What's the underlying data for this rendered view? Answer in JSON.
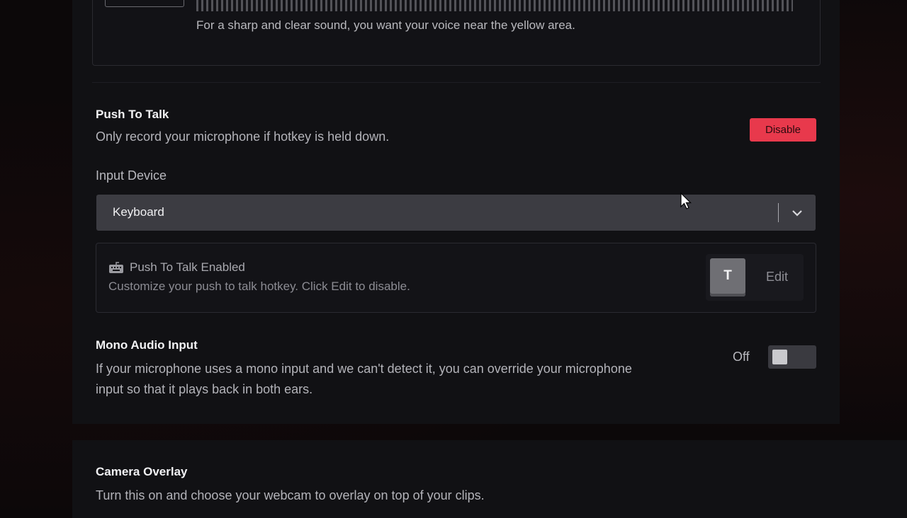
{
  "mic_level": {
    "hint": "For a sharp and clear sound, you want your voice near the yellow area."
  },
  "push_to_talk": {
    "title": "Push To Talk",
    "description": "Only record your microphone if hotkey is held down.",
    "disable_label": "Disable",
    "accent_color": "#e8394c",
    "input_device_label": "Input Device",
    "input_device_value": "Keyboard",
    "status_title": "Push To Talk Enabled",
    "status_description": "Customize your push to talk hotkey. Click Edit to disable.",
    "hotkey": "T",
    "edit_label": "Edit",
    "icons": {
      "status": "keyboard-icon",
      "dropdown": "chevron-down-icon"
    }
  },
  "mono_audio": {
    "title": "Mono Audio Input",
    "description_line1": "If your microphone uses a mono input and we can't detect it, you can override your microphone",
    "description_line2": "input so that it plays back in both ears.",
    "toggle_state": "Off"
  },
  "camera_overlay": {
    "title": "Camera Overlay",
    "description": "Turn this on and choose your webcam to overlay on top of your clips."
  }
}
